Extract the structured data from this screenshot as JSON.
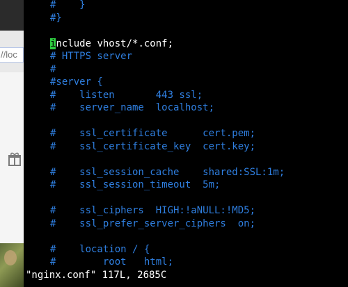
{
  "browser": {
    "url_text": "//loc",
    "icon": "gift-icon"
  },
  "editor": {
    "lines": [
      {
        "text": "#    }",
        "kind": "comment"
      },
      {
        "text": "#}",
        "kind": "comment"
      },
      {
        "text": "",
        "kind": "blank"
      },
      {
        "text": "include vhost/*.conf;",
        "kind": "plain",
        "cursor_index": 0
      },
      {
        "text": "# HTTPS server",
        "kind": "comment"
      },
      {
        "text": "#",
        "kind": "comment"
      },
      {
        "text": "#server {",
        "kind": "comment"
      },
      {
        "text": "#    listen       443 ssl;",
        "kind": "comment"
      },
      {
        "text": "#    server_name  localhost;",
        "kind": "comment"
      },
      {
        "text": "",
        "kind": "blank"
      },
      {
        "text": "#    ssl_certificate      cert.pem;",
        "kind": "comment"
      },
      {
        "text": "#    ssl_certificate_key  cert.key;",
        "kind": "comment"
      },
      {
        "text": "",
        "kind": "blank"
      },
      {
        "text": "#    ssl_session_cache    shared:SSL:1m;",
        "kind": "comment"
      },
      {
        "text": "#    ssl_session_timeout  5m;",
        "kind": "comment"
      },
      {
        "text": "",
        "kind": "blank"
      },
      {
        "text": "#    ssl_ciphers  HIGH:!aNULL:!MD5;",
        "kind": "comment"
      },
      {
        "text": "#    ssl_prefer_server_ciphers  on;",
        "kind": "comment"
      },
      {
        "text": "",
        "kind": "blank"
      },
      {
        "text": "#    location / {",
        "kind": "comment"
      },
      {
        "text": "#        root   html;",
        "kind": "comment"
      }
    ],
    "status": "\"nginx.conf\" 117L, 2685C",
    "colors": {
      "comment": "#2f7fe0",
      "plain": "#ffffff",
      "cursor": "#2ecc40",
      "background": "#000000"
    }
  }
}
